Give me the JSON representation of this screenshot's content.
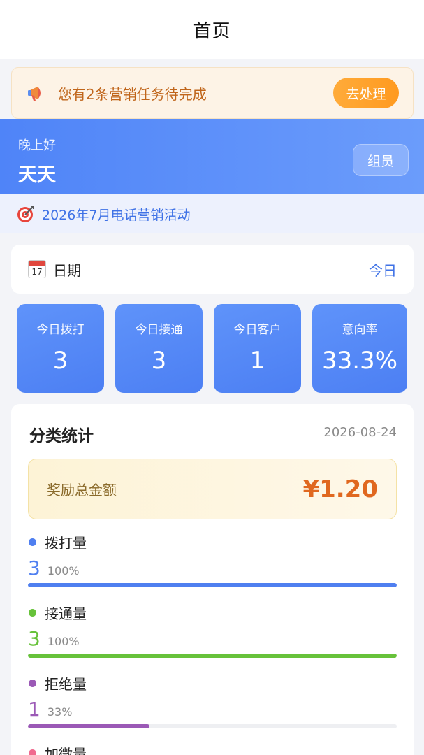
{
  "nav": {
    "title": "首页"
  },
  "notice": {
    "text": "您有2条营销任务待完成",
    "button": "去处理",
    "icon": "megaphone-icon"
  },
  "greeting": {
    "hello": "晚上好",
    "name": "天天",
    "role": "组员"
  },
  "campaign": {
    "text": "2026年7月电话营销活动",
    "icon": "target-icon"
  },
  "date_filter": {
    "label": "日期",
    "value": "今日",
    "icon": "calendar-icon",
    "icon_text": "17"
  },
  "stats": [
    {
      "label": "今日拨打",
      "value": "3"
    },
    {
      "label": "今日接通",
      "value": "3"
    },
    {
      "label": "今日客户",
      "value": "1"
    },
    {
      "label": "意向率",
      "value": "33.3%"
    }
  ],
  "category": {
    "title": "分类统计",
    "date": "2026-08-24",
    "reward_label": "奖励总金额",
    "reward_value": "¥1.20",
    "metrics": [
      {
        "name": "拨打量",
        "count": "3",
        "percent": "100%",
        "ratio": 1.0,
        "color": "#4f7ff0"
      },
      {
        "name": "接通量",
        "count": "3",
        "percent": "100%",
        "ratio": 1.0,
        "color": "#67c23a"
      },
      {
        "name": "拒绝量",
        "count": "1",
        "percent": "33%",
        "ratio": 0.33,
        "color": "#9b59b6"
      },
      {
        "name": "加微量",
        "color": "#f06a8f"
      }
    ]
  }
}
